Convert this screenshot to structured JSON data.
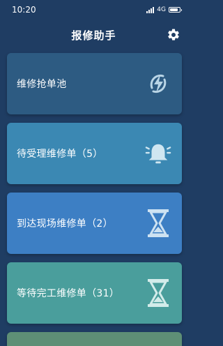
{
  "status": {
    "time": "10:20",
    "network": "4G"
  },
  "header": {
    "title": "报修助手"
  },
  "cards": [
    {
      "label": "维修抢单池",
      "icon": "lightning-icon",
      "color": "#2d5b82"
    },
    {
      "label": "待受理维修单（5）",
      "icon": "bell-icon",
      "color": "#3b88b3"
    },
    {
      "label": "到达现场维修单（2）",
      "icon": "hourglass-icon",
      "color": "#3d7fc4"
    },
    {
      "label": "等待完工维修单（31）",
      "icon": "hourglass-icon",
      "color": "#4a9e9c"
    },
    {
      "label": "",
      "icon": "",
      "color": "#5e8f76"
    }
  ]
}
